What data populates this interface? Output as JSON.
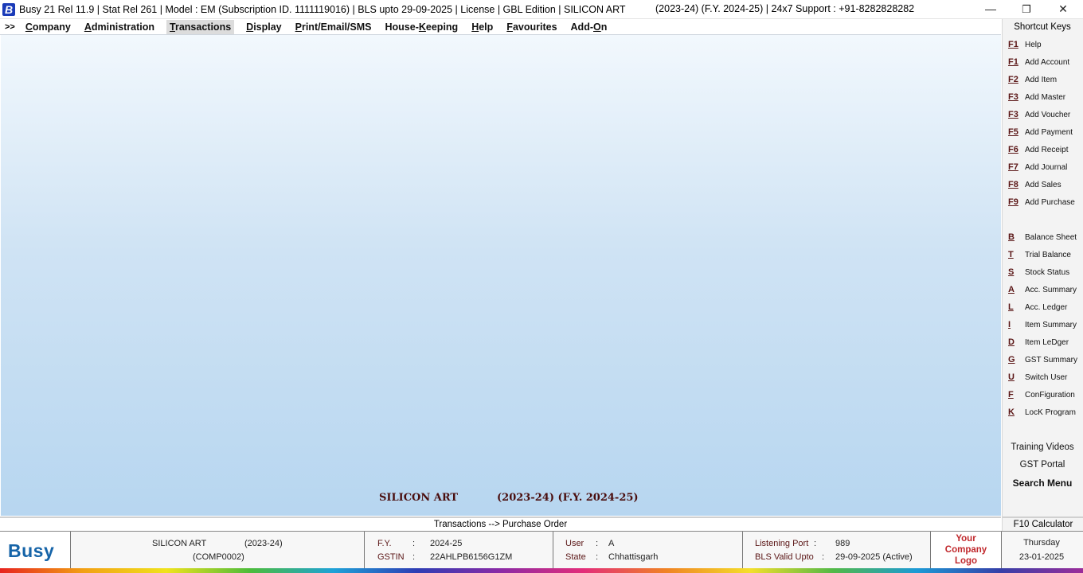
{
  "window": {
    "logo_letter": "B",
    "title": "Busy 21  Rel 11.9  |  Stat Rel 261  |  Model : EM (Subscription ID. 1111119016)  | BLS upto 29-09-2025  |  License  |  GBL Edition  |  SILICON ART",
    "title_right": "(2023-24) (F.Y. 2024-25)  |   24x7 Support : +91-8282828282",
    "minimize": "—",
    "maximize": "❐",
    "close": "✕"
  },
  "menu": {
    "chevron": ">>",
    "items": [
      {
        "pre": "",
        "u": "C",
        "post": "ompany"
      },
      {
        "pre": "",
        "u": "A",
        "post": "dministration"
      },
      {
        "pre": "",
        "u": "T",
        "post": "ransactions"
      },
      {
        "pre": "",
        "u": "D",
        "post": "isplay"
      },
      {
        "pre": "",
        "u": "P",
        "post": "rint/Email/SMS"
      },
      {
        "pre": "House-",
        "u": "K",
        "post": "eeping"
      },
      {
        "pre": "",
        "u": "H",
        "post": "elp"
      },
      {
        "pre": "",
        "u": "F",
        "post": "avourites"
      },
      {
        "pre": "Add-",
        "u": "O",
        "post": "n"
      }
    ]
  },
  "main": {
    "company": "SILICON ART",
    "fy": "(2023-24) (F.Y. 2024-25)"
  },
  "shortcuts": {
    "header": "Shortcut Keys",
    "fkeys": [
      {
        "key": "F1",
        "label": "Help"
      },
      {
        "key": "F1",
        "label": "Add Account"
      },
      {
        "key": "F2",
        "label": "Add Item"
      },
      {
        "key": "F3",
        "label": "Add Master"
      },
      {
        "key": "F3",
        "label": "Add Voucher"
      },
      {
        "key": "F5",
        "label": "Add Payment"
      },
      {
        "key": "F6",
        "label": "Add Receipt"
      },
      {
        "key": "F7",
        "label": "Add Journal"
      },
      {
        "key": "F8",
        "label": "Add Sales"
      },
      {
        "key": "F9",
        "label": "Add Purchase"
      }
    ],
    "letters": [
      {
        "key": "B",
        "label": "Balance Sheet"
      },
      {
        "key": "T",
        "label": "Trial Balance"
      },
      {
        "key": "S",
        "label": "Stock Status"
      },
      {
        "key": "A",
        "label": "Acc. Summary"
      },
      {
        "key": "L",
        "label": "Acc. Ledger"
      },
      {
        "key": "I",
        "label": "Item Summary"
      },
      {
        "key": "D",
        "label": "Item LeDger"
      },
      {
        "key": "G",
        "label": "GST Summary"
      },
      {
        "key": "U",
        "label": "Switch User"
      },
      {
        "key": "F",
        "label": "ConFiguration"
      },
      {
        "key": "K",
        "label": "LocK Program"
      }
    ],
    "training_videos": "Training Videos",
    "gst_portal": "GST Portal",
    "search_menu": "Search Menu"
  },
  "status": {
    "path": "Transactions --> Purchase Order",
    "calculator": "F10 Calculator"
  },
  "footer": {
    "brand": "Busy",
    "company_name": "SILICON ART",
    "company_year": "(2023-24)",
    "company_code": "(COMP0002)",
    "fy_label": "F.Y.",
    "fy_value": "2024-25",
    "gstin_label": "GSTIN",
    "gstin_value": "22AHLPB6156G1ZM",
    "user_label": "User",
    "user_value": "A",
    "state_label": "State",
    "state_value": "Chhattisgarh",
    "port_label": "Listening Port",
    "port_value": "989",
    "bls_label": "BLS Valid Upto",
    "bls_value": "29-09-2025 (Active)",
    "colon": ":",
    "logo_line1": "Your",
    "logo_line2": "Company",
    "logo_line3": "Logo",
    "day": "Thursday",
    "date": "23-01-2025"
  }
}
